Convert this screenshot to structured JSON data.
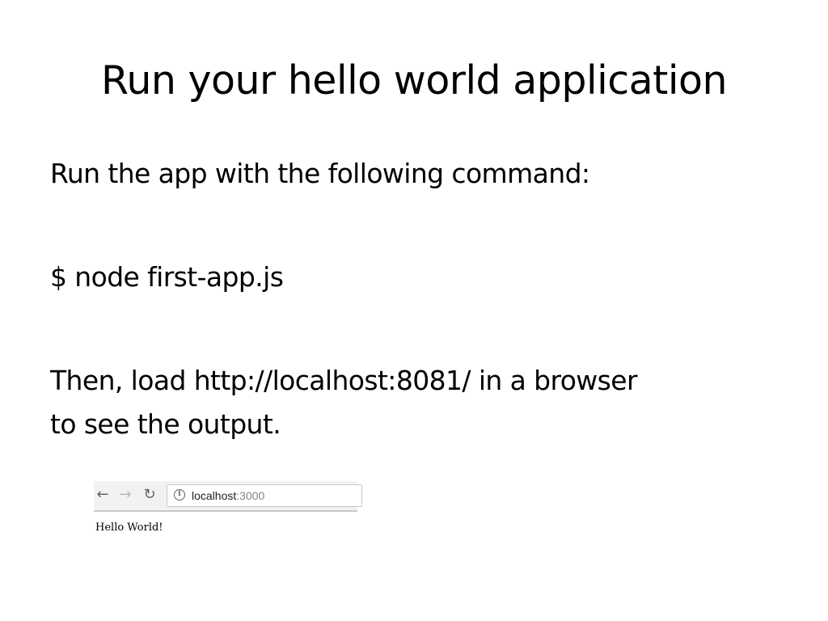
{
  "slide": {
    "title": "Run your hello world application",
    "line1": "Run the app with the following command:",
    "command": "$ node first-app.js",
    "line3a": "Then, load http://localhost:8081/ in a browser",
    "line3b": "to see the output."
  },
  "browser": {
    "icons": {
      "back": "back-arrow-icon",
      "forward": "forward-arrow-icon",
      "reload": "reload-icon",
      "info": "info-icon"
    },
    "url_host": "localhost",
    "url_port": ":3000",
    "page_text": "Hello World!"
  }
}
